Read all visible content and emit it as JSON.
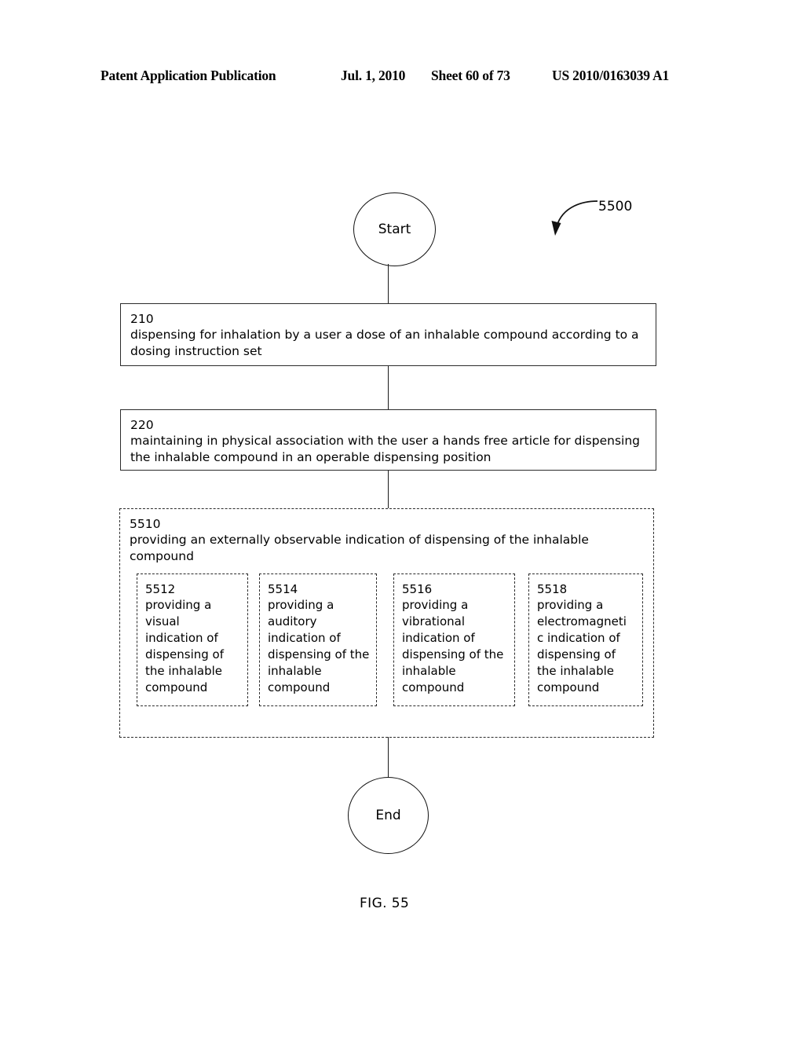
{
  "header": {
    "publication": "Patent Application Publication",
    "date": "Jul. 1, 2010",
    "sheet": "Sheet 60 of 73",
    "patent_number": "US 2010/0163039 A1"
  },
  "figure": {
    "caption": "FIG. 55",
    "callout_ref": "5500"
  },
  "flow": {
    "start_label": "Start",
    "end_label": "End",
    "steps": [
      {
        "ref": "210",
        "text": "dispensing for inhalation by a user a dose of an inhalable compound according to a dosing instruction set"
      },
      {
        "ref": "220",
        "text": "maintaining in physical association with the user a hands free article for dispensing the inhalable compound in an operable dispensing position"
      }
    ],
    "group": {
      "ref": "5510",
      "text": "providing an externally observable indication of dispensing of the inhalable compound",
      "substeps": [
        {
          "ref": "5512",
          "text": "providing a visual indication of dispensing of the inhalable compound"
        },
        {
          "ref": "5514",
          "text": "providing a auditory indication of dispensing of the inhalable compound"
        },
        {
          "ref": "5516",
          "text": "providing a vibrational indication of dispensing of the inhalable compound"
        },
        {
          "ref": "5518",
          "text": "providing a electromagneti c indication of dispensing of the inhalable compound"
        }
      ]
    }
  },
  "colors": {
    "page_background": "#ffffff",
    "ink": "#000000",
    "line": "#2b2b2b"
  }
}
